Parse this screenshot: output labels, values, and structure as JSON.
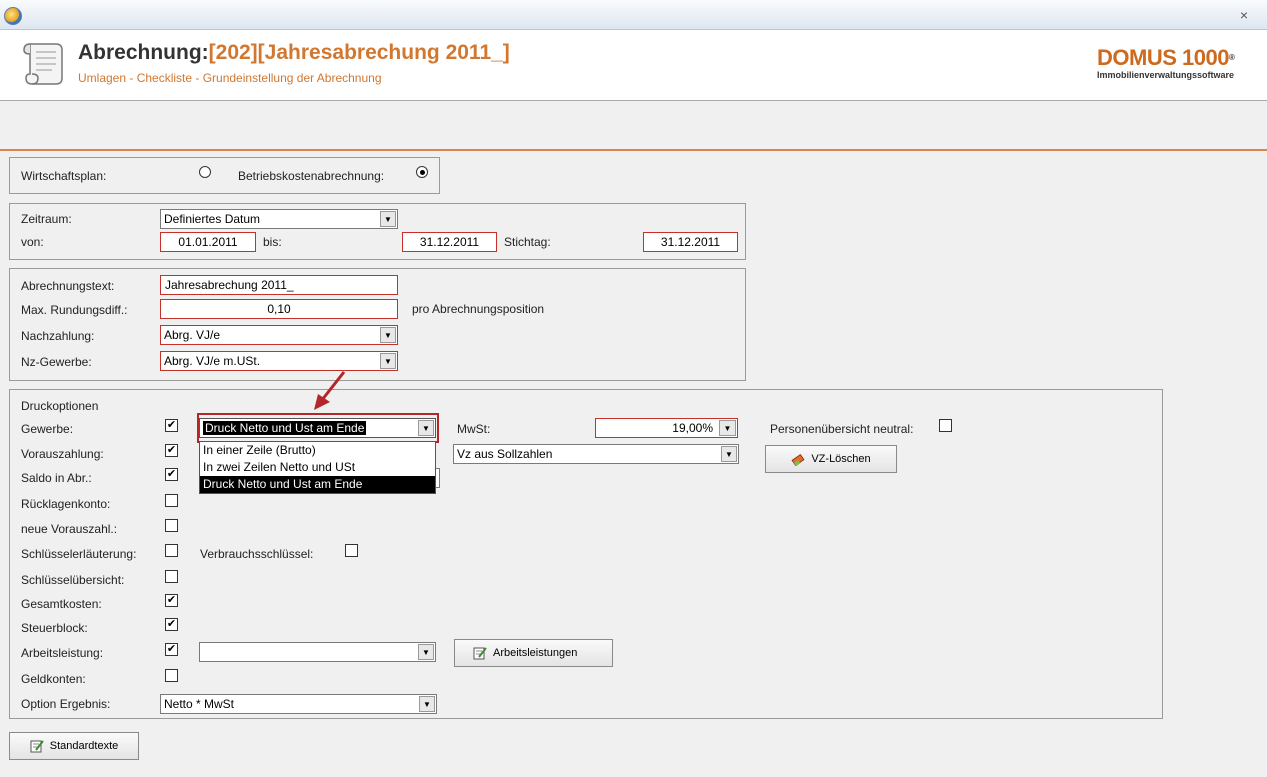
{
  "window": {
    "close_label": "×"
  },
  "header": {
    "title_prefix": "Abrechnung:",
    "title_highlight": "[202][Jahresabrechung 2011_]",
    "subtitle": "Umlagen - Checkliste - Grundeinstellung der Abrechnung",
    "logo_main": "DOMUS 1000",
    "logo_reg": "®",
    "logo_sub": "Immobilienverwaltungssoftware"
  },
  "plan": {
    "wirtschaftsplan_label": "Wirtschaftsplan:",
    "betriebskosten_label": "Betriebskostenabrechnung:",
    "selected": "Betriebskostenabrechnung"
  },
  "zeitraum": {
    "label": "Zeitraum:",
    "value": "Definiertes Datum",
    "von_label": "von:",
    "von_value": "01.01.2011",
    "bis_label": "bis:",
    "bis_value": "31.12.2011",
    "stichtag_label": "Stichtag:",
    "stichtag_value": "31.12.2011"
  },
  "abrechnung": {
    "text_label": "Abrechnungstext:",
    "text_value": "Jahresabrechung 2011_",
    "rund_label": "Max. Rundungsdiff.:",
    "rund_value": "0,10",
    "rund_suffix": "pro Abrechnungsposition",
    "nachzahlung_label": "Nachzahlung:",
    "nachzahlung_value": "Abrg. VJ/e",
    "nzgewerbe_label": "Nz-Gewerbe:",
    "nzgewerbe_value": "Abrg. VJ/e m.USt."
  },
  "druck": {
    "title": "Druckoptionen",
    "gewerbe_label": "Gewerbe:",
    "gewerbe_value": "Druck Netto und  Ust am Ende",
    "gewerbe_options": [
      "In einer Zeile  (Brutto)",
      "In zwei Zeilen Netto und USt",
      "Druck Netto und  Ust am Ende"
    ],
    "mwst_label": "MwSt:",
    "mwst_value": "19,00%",
    "personen_label": "Personenübersicht neutral:",
    "vorauszahlung_label": "Vorauszahlung:",
    "vz_value": "Vz aus Sollzahlen",
    "vz_loeschen_label": "VZ-Löschen",
    "saldo_label": "Saldo in Abr.:",
    "ruecklagen_label": "Rücklagenkonto:",
    "neue_vz_label": "neue Vorauszahl.:",
    "schluessel_erl_label": "Schlüsselerläuterung:",
    "verbrauch_label": "Verbrauchsschlüssel:",
    "schluessel_ueb_label": "Schlüsselübersicht:",
    "gesamtkosten_label": "Gesamtkosten:",
    "steuerblock_label": "Steuerblock:",
    "arbeitsleistung_label": "Arbeitsleistung:",
    "arbeitsleistung_value": "",
    "arbeitsleistungen_btn": "Arbeitsleistungen",
    "geldkonten_label": "Geldkonten:",
    "option_label": "Option Ergebnis:",
    "option_value": "Netto * MwSt",
    "check": "✔"
  },
  "footer": {
    "standardtexte_label": "Standardtexte"
  }
}
